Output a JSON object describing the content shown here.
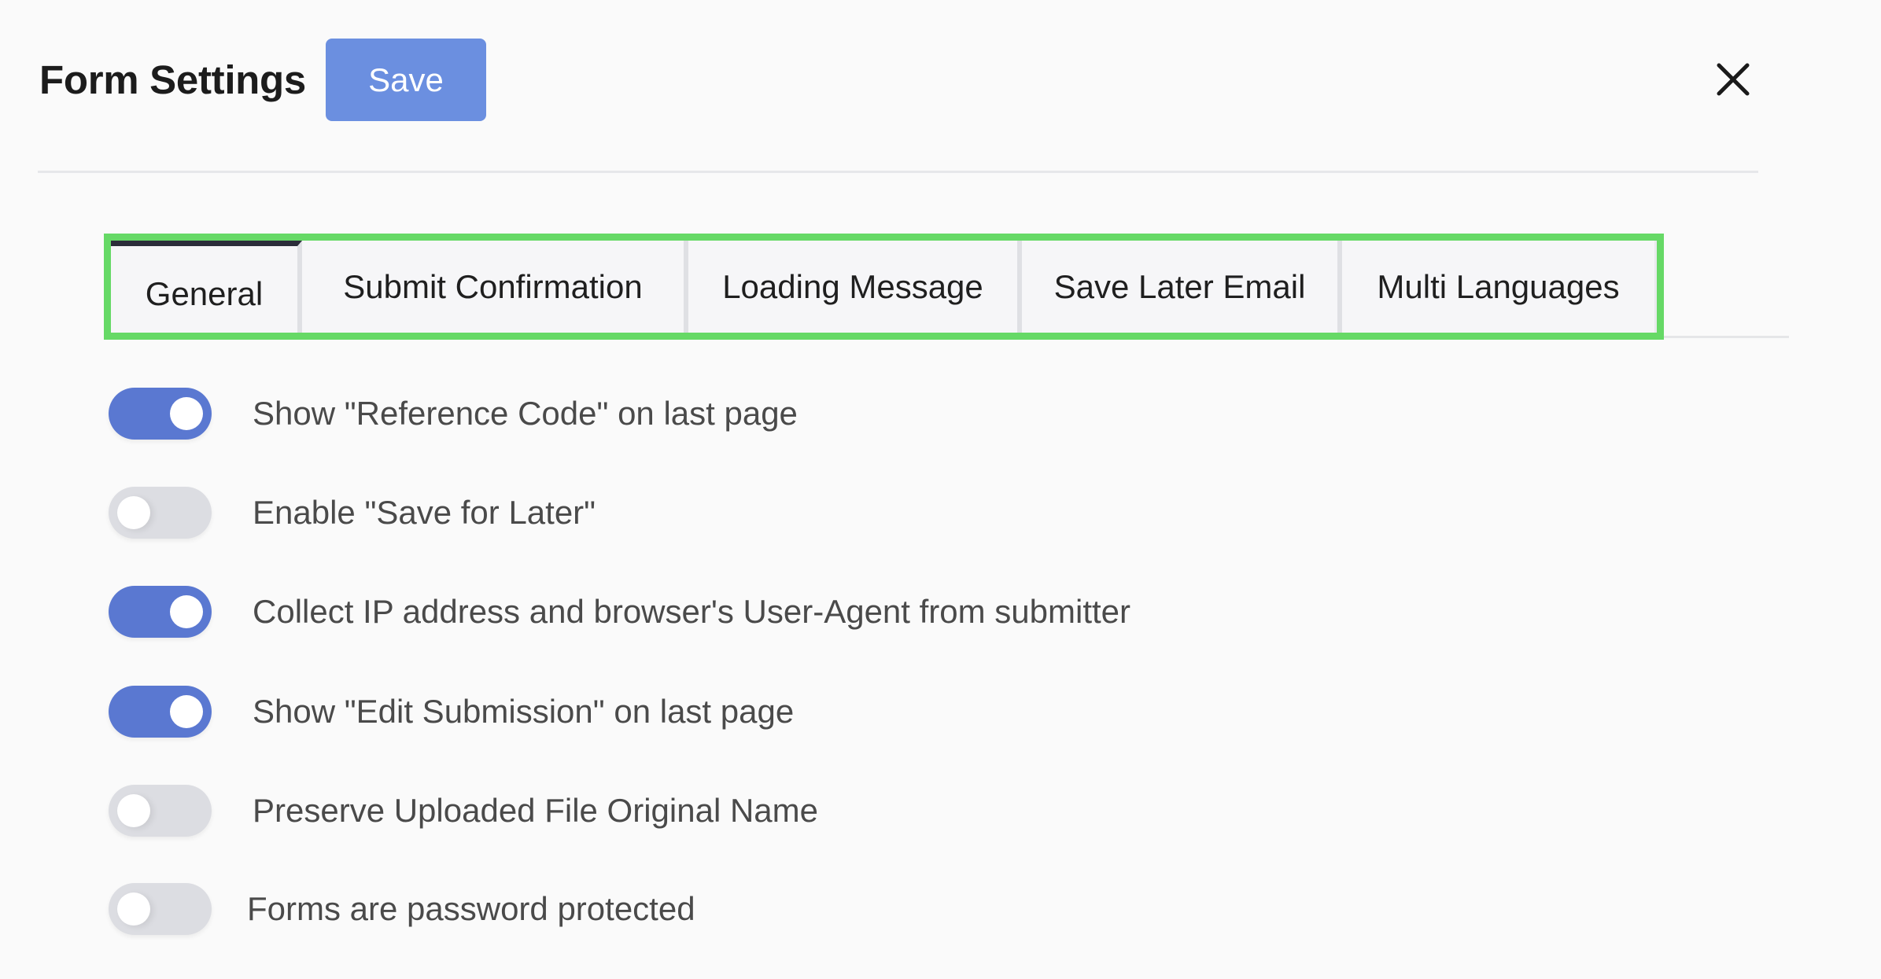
{
  "header": {
    "title": "Form Settings",
    "save_label": "Save",
    "close_icon": "close-icon"
  },
  "tabs": [
    {
      "label": "General",
      "active": true
    },
    {
      "label": "Submit Confirmation",
      "active": false
    },
    {
      "label": "Loading Message",
      "active": false
    },
    {
      "label": "Save Later Email",
      "active": false
    },
    {
      "label": "Multi Languages",
      "active": false
    }
  ],
  "settings": [
    {
      "label": "Show \"Reference Code\" on last page",
      "enabled": true
    },
    {
      "label": "Enable \"Save for Later\"",
      "enabled": false
    },
    {
      "label": "Collect IP address and browser's User-Agent from submitter",
      "enabled": true
    },
    {
      "label": "Show \"Edit Submission\" on last page",
      "enabled": true
    },
    {
      "label": "Preserve Uploaded File Original Name",
      "enabled": false
    },
    {
      "label": "Forms are password protected",
      "enabled": false
    }
  ],
  "colors": {
    "primary": "#6b8fe0",
    "toggle_on": "#5a78d1",
    "toggle_off": "#dcdde2",
    "highlight_border": "#66d966",
    "active_tab_indicator": "#2b2d3a"
  }
}
